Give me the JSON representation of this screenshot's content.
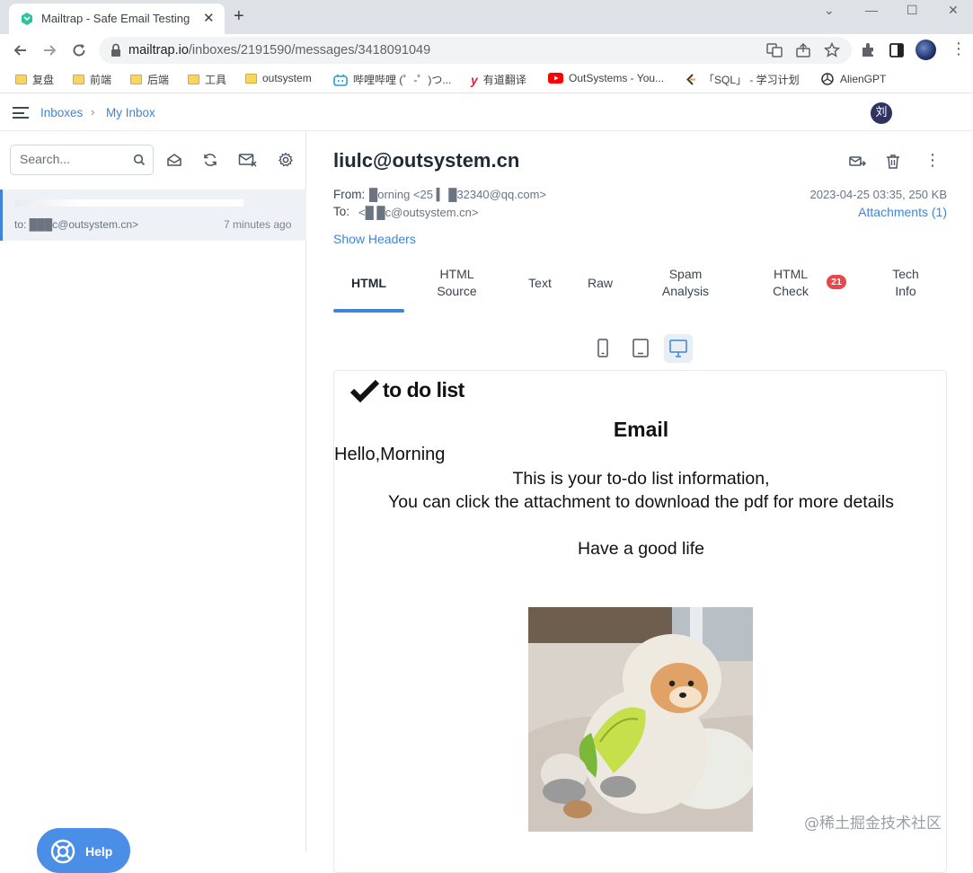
{
  "browser": {
    "tab_title": "Mailtrap - Safe Email Testing",
    "url_host": "mailtrap.io",
    "url_path": "/inboxes/2191590/messages/3418091049",
    "bookmarks": [
      "复盘",
      "前端",
      "后端",
      "工具",
      "outsystem",
      "哔哩哔哩 (゜-゜)つ...",
      "有道翻译",
      "OutSystems - You...",
      "「SQL」 - 学习计划",
      "AlienGPT"
    ]
  },
  "header": {
    "crumb_inboxes": "Inboxes",
    "crumb_separator": "›",
    "crumb_myinbox": "My Inbox",
    "avatar_initial": "刘"
  },
  "sidebar": {
    "search_placeholder": "Search...",
    "help_label": "Help",
    "message": {
      "to": "to: ███c@outsystem.cn>",
      "time": "7 minutes ago"
    }
  },
  "mail": {
    "subject": "liulc@outsystem.cn",
    "from_label": "From:",
    "from_value": "█orning <25 ▍ █32340@qq.com>",
    "to_label": "To:",
    "to_value": "<█ █c@outsystem.cn>",
    "datesize": "2023-04-25 03:35, 250 KB",
    "attachments": "Attachments (1)",
    "show_headers": "Show Headers",
    "tabs": [
      {
        "l1": "HTML",
        "l2": ""
      },
      {
        "l1": "HTML",
        "l2": "Source"
      },
      {
        "l1": "Text",
        "l2": ""
      },
      {
        "l1": "Raw",
        "l2": ""
      },
      {
        "l1": "Spam",
        "l2": "Analysis"
      },
      {
        "l1": "HTML",
        "l2": "Check"
      },
      {
        "l1": "Tech",
        "l2": "Info"
      }
    ],
    "html_check_badge": "21",
    "active_tab": "HTML"
  },
  "email_body": {
    "logo_text": "to do list",
    "heading": "Email",
    "greeting": "Hello,Morning",
    "line1": "This is your to-do list information,",
    "line2": "You can click the attachment to download the pdf for more details",
    "line3": "Have a good life"
  },
  "watermark": "@稀土掘金技术社区",
  "colors": {
    "accent": "#3f84d8",
    "badge": "#e5484d",
    "help_button": "#4a8ee8"
  }
}
